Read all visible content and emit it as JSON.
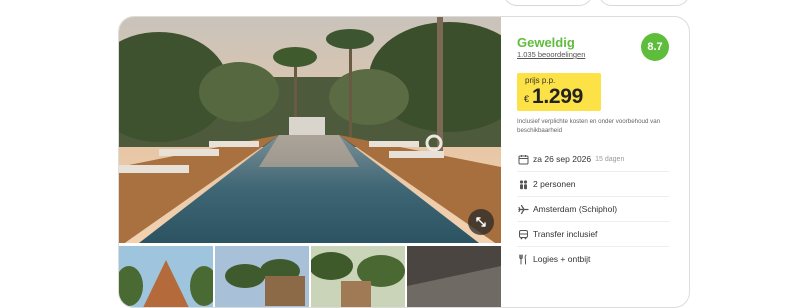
{
  "rating": {
    "label": "Geweldig",
    "reviews": "1.035 beoordelingen",
    "score": "8.7"
  },
  "price": {
    "label": "prijs p.p.",
    "currency": "€",
    "amount": "1.299"
  },
  "note": "Inclusief verplichte kosten en onder voorbehoud van beschikbaarheid",
  "details": [
    {
      "icon": "calendar-icon",
      "text": "za 26 sep 2026",
      "sub": "15 dagen"
    },
    {
      "icon": "people-icon",
      "text": "2 personen"
    },
    {
      "icon": "plane-icon",
      "text": "Amsterdam (Schiphol)"
    },
    {
      "icon": "bus-icon",
      "text": "Transfer inclusief"
    },
    {
      "icon": "fork-icon",
      "text": "Logies + ontbijt"
    }
  ],
  "colors": {
    "rating_green": "#5fbd3c",
    "price_yellow": "#fde247"
  }
}
